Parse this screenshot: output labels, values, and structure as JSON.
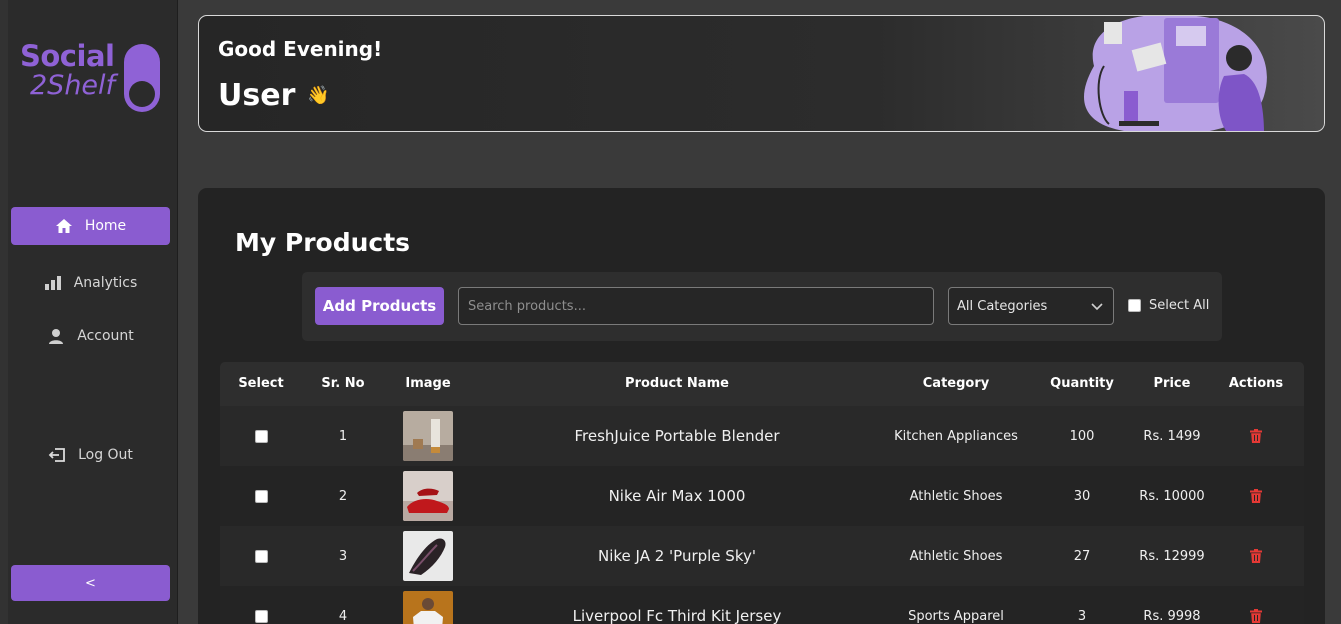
{
  "brand": {
    "line1": "Social",
    "line2": "2Shelf"
  },
  "sidebar": {
    "items": [
      {
        "label": "Home",
        "icon": "home-icon",
        "active": true
      },
      {
        "label": "Analytics",
        "icon": "bar-chart-icon",
        "active": false
      },
      {
        "label": "Account",
        "icon": "user-icon",
        "active": false
      }
    ],
    "logout_label": "Log Out",
    "collapse_label": "<"
  },
  "greeting": {
    "salutation": "Good Evening!",
    "user": "User",
    "emoji": "👋"
  },
  "products": {
    "title": "My Products",
    "add_label": "Add Products",
    "search_placeholder": "Search products...",
    "category_selected": "All Categories",
    "select_all_label": "Select All",
    "columns": [
      "Select",
      "Sr. No",
      "Image",
      "Product Name",
      "Category",
      "Quantity",
      "Price",
      "Actions"
    ],
    "rows": [
      {
        "sr": "1",
        "name": "FreshJuice Portable Blender",
        "category": "Kitchen Appliances",
        "quantity": "100",
        "price": "Rs. 1499",
        "image": "blender-photo"
      },
      {
        "sr": "2",
        "name": "Nike Air Max 1000",
        "category": "Athletic Shoes",
        "quantity": "30",
        "price": "Rs. 10000",
        "image": "red-shoe-photo"
      },
      {
        "sr": "3",
        "name": "Nike JA 2 'Purple Sky'",
        "category": "Athletic Shoes",
        "quantity": "27",
        "price": "Rs. 12999",
        "image": "dark-shoe-photo"
      },
      {
        "sr": "4",
        "name": "Liverpool Fc Third Kit Jersey",
        "category": "Sports Apparel",
        "quantity": "3",
        "price": "Rs. 9998",
        "image": "jersey-photo"
      }
    ]
  },
  "colors": {
    "accent": "#8a5cd0",
    "danger": "#e53935",
    "background": "#3a3a3a"
  }
}
